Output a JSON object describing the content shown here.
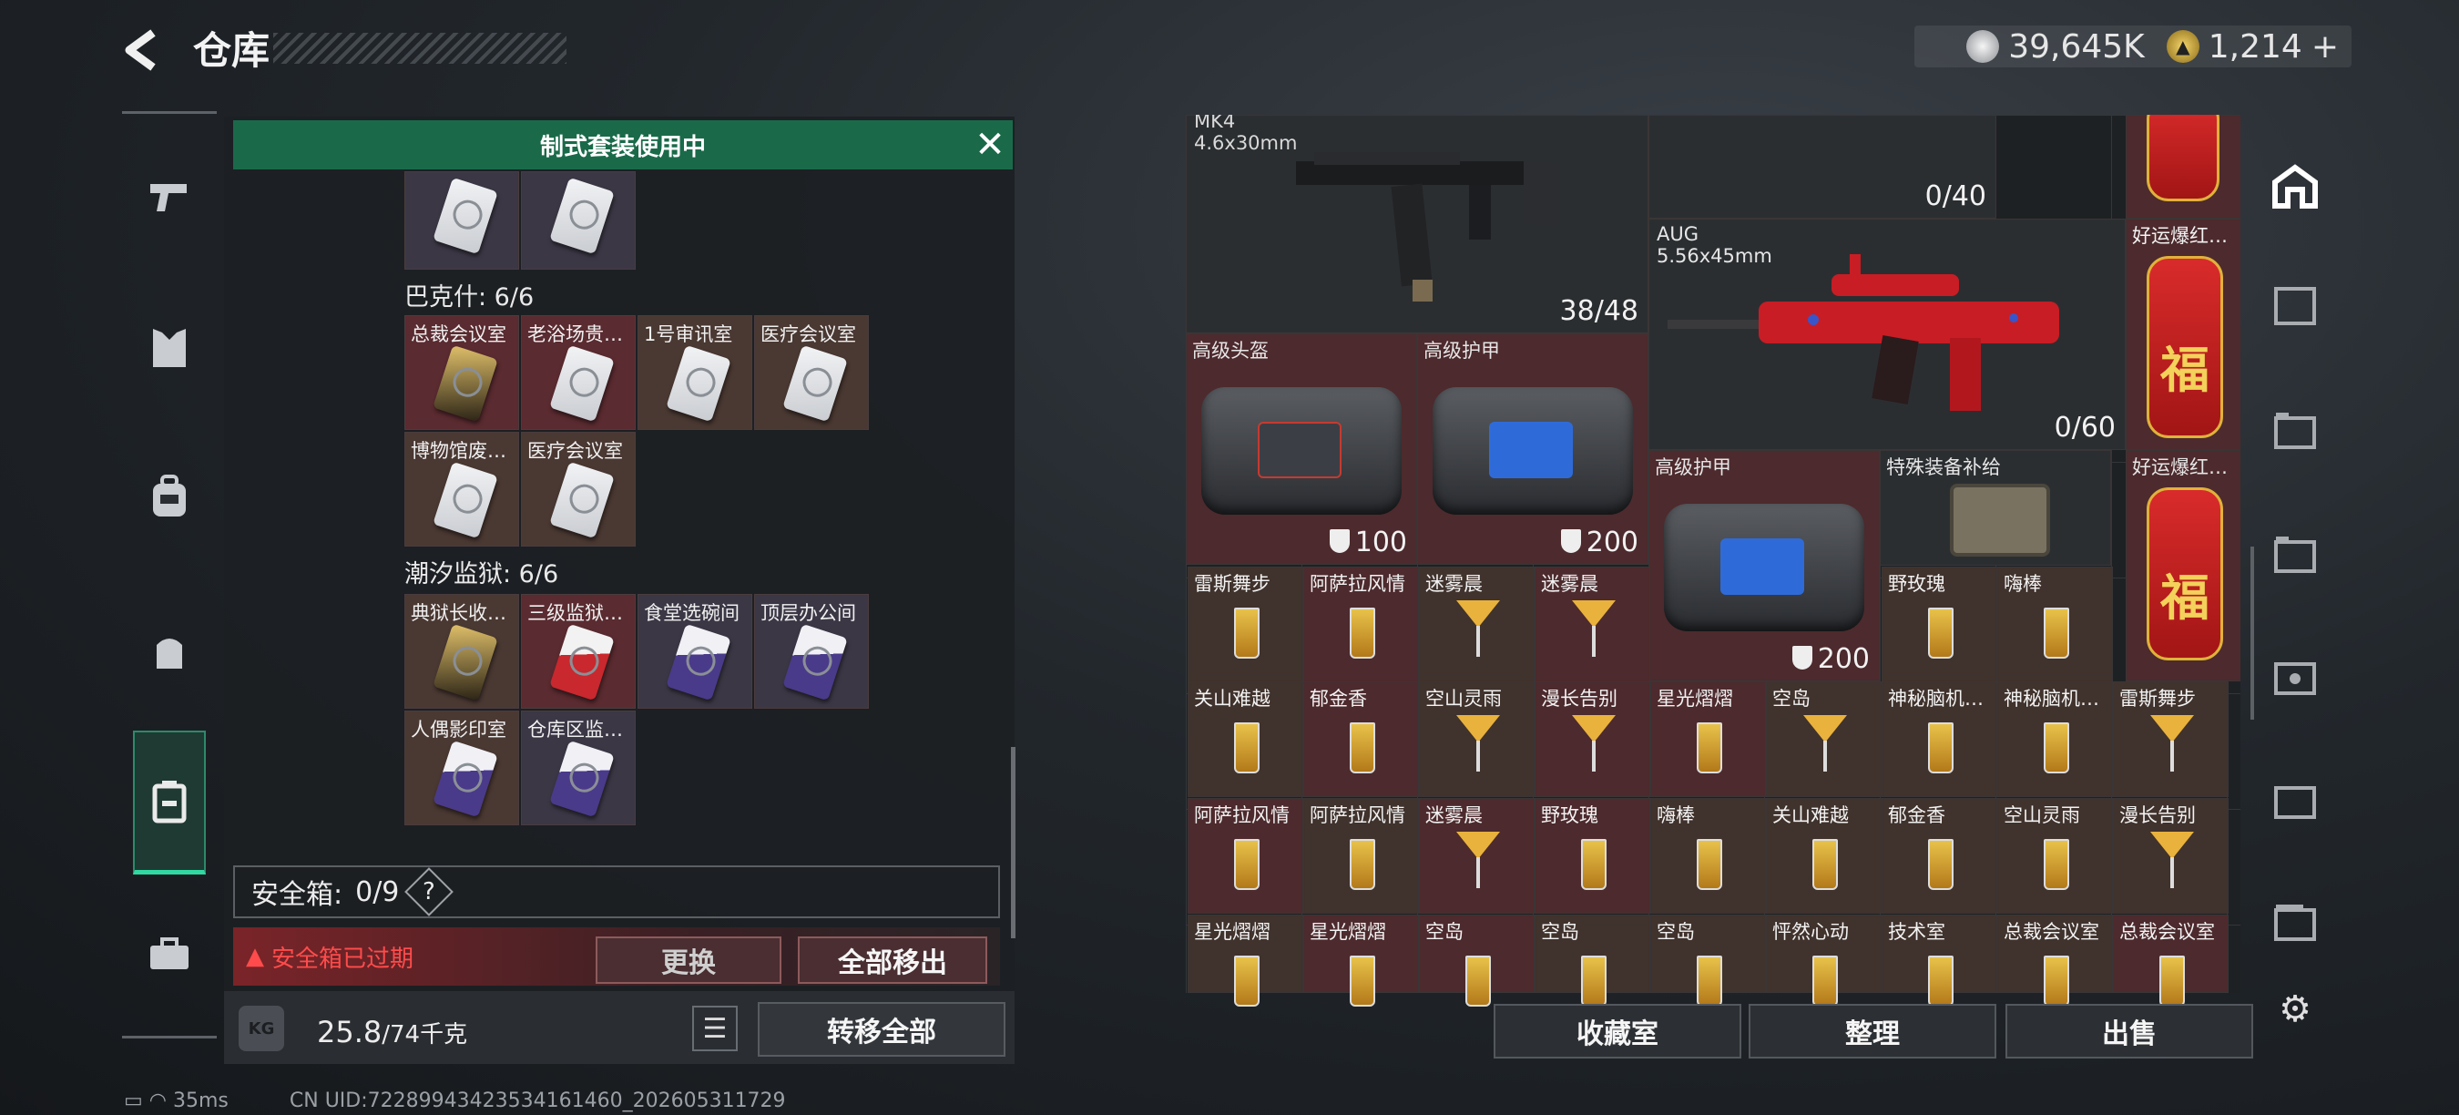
{
  "header": {
    "title": "仓库",
    "currency1": "39,645K",
    "currency2": "1,214",
    "currency2_suffix": "+"
  },
  "left_nav": [
    "pistol-icon",
    "armor-icon",
    "backpack-icon",
    "rig-icon",
    "case-icon",
    "toolbox-icon"
  ],
  "kit_banner": "制式套装使用中",
  "sections": [
    {
      "title": "巴克什: 6/6",
      "cards": [
        "总裁会议室",
        "老浴场贵…",
        "1号审讯室",
        "医疗会议室",
        "博物馆废…",
        "医疗会议室"
      ]
    },
    {
      "title": "潮汐监狱: 6/6",
      "cards": [
        "典狱长收…",
        "三级监狱…",
        "食堂选碗间",
        "顶层办公间",
        "人偶影印室",
        "仓库区监…"
      ]
    }
  ],
  "safebox": {
    "label": "安全箱:",
    "count": "0/9",
    "help": "?"
  },
  "expired": {
    "text": "安全箱已过期",
    "replace": "更换",
    "move_all": "全部移出"
  },
  "weight": {
    "current": "25.8",
    "max": "/74千克",
    "unit_icon": "KG"
  },
  "transfer_all": "转移全部",
  "stash": {
    "mk4": {
      "name": "MK4",
      "caliber": "4.6x30mm",
      "qty": "38/48",
      "qty_top": "0/40"
    },
    "aug": {
      "name": "AUG",
      "caliber": "5.56x45mm",
      "qty": "0/60"
    },
    "luck1": "好运爆红…",
    "luck2": "好运爆红…",
    "fu_char": "福",
    "helmet_bag": {
      "name": "高级头盔",
      "value": "100"
    },
    "armor_bag1": {
      "name": "高级护甲",
      "value": "200"
    },
    "armor_bag2": {
      "name": "高级护甲",
      "value": "200"
    },
    "special": "特殊装备补给",
    "row_a": [
      "雷斯舞步",
      "阿萨拉风情",
      "迷雾晨",
      "迷雾晨"
    ],
    "row_a2": [
      "野玫瑰",
      "嗨棒"
    ],
    "row_b": [
      "关山难越",
      "郁金香",
      "空山灵雨",
      "漫长告别",
      "星光熠熠",
      "空岛",
      "神秘脑机…",
      "神秘脑机…",
      "雷斯舞步"
    ],
    "row_c": [
      "阿萨拉风情",
      "阿萨拉风情",
      "迷雾晨",
      "野玫瑰",
      "嗨棒",
      "关山难越",
      "郁金香",
      "空山灵雨",
      "漫长告别"
    ],
    "row_d": [
      "星光熠熠",
      "星光熠熠",
      "空岛",
      "空岛",
      "空岛",
      "怦然心动",
      "技术室",
      "总裁会议室",
      "总裁会议室"
    ]
  },
  "bottom_buttons": [
    "收藏室",
    "整理",
    "出售"
  ],
  "status": {
    "ping": "35ms",
    "uid": "CN UID:7228994342353416146​0_202605311729"
  }
}
